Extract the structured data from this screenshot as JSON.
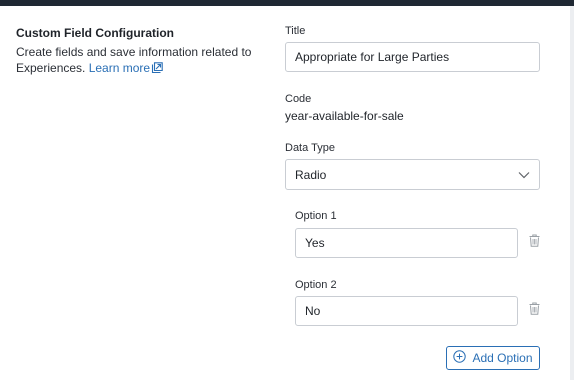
{
  "config": {
    "section_title": "Custom Field Configuration",
    "description": "Create fields and save information related to Experiences.",
    "learn_more": "Learn more"
  },
  "form": {
    "title_label": "Title",
    "title_value": "Appropriate for Large Parties",
    "code_label": "Code",
    "code_value": "year-available-for-sale",
    "data_type_label": "Data Type",
    "data_type_value": "Radio",
    "options": [
      {
        "label": "Option 1",
        "value": "Yes"
      },
      {
        "label": "Option 2",
        "value": "No"
      }
    ],
    "add_option_label": "Add Option"
  },
  "icons": {
    "learn_more": "external-link-icon",
    "dropdown": "chevron-down-icon",
    "delete": "trash-icon",
    "add": "plus-circle-icon"
  },
  "colors": {
    "topbar": "#1f2833",
    "link": "#2a6fb5",
    "border": "#c9cdd3",
    "icon_muted": "#9aa0a6"
  }
}
